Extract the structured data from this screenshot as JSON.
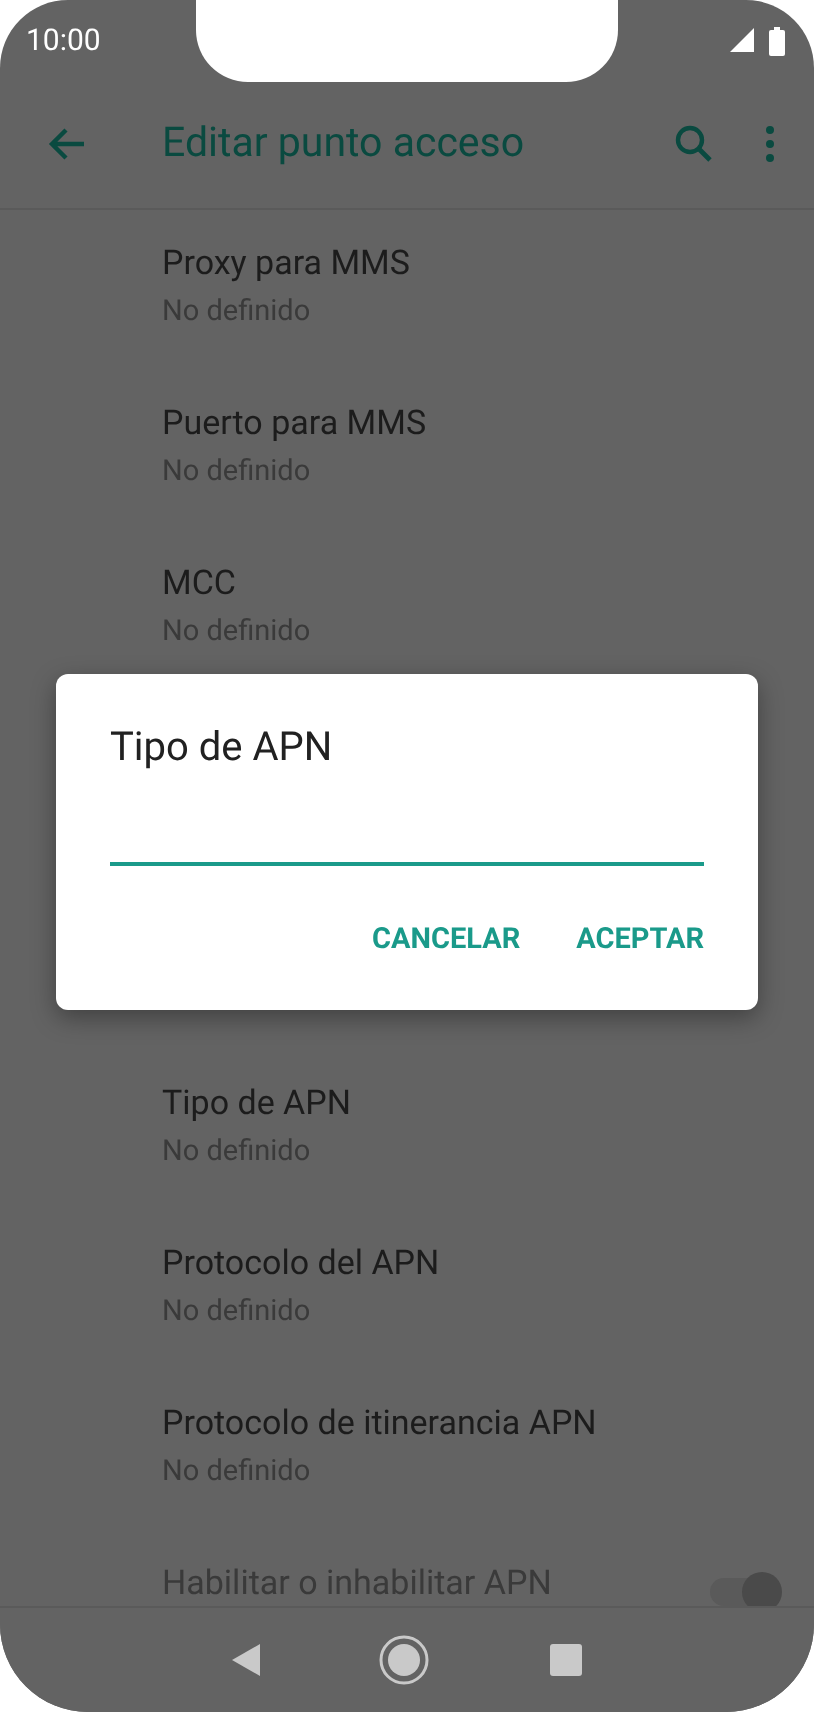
{
  "status_bar": {
    "time": "10:00"
  },
  "app_bar": {
    "title": "Editar punto acceso"
  },
  "settings": [
    {
      "kind": "text",
      "title": "Proxy para MMS",
      "value": "No definido"
    },
    {
      "kind": "text",
      "title": "Puerto para MMS",
      "value": "No definido"
    },
    {
      "kind": "text",
      "title": "MCC",
      "value": "No definido"
    }
  ],
  "dialog": {
    "title": "Tipo de APN",
    "buttons": [
      "CANCELAR",
      "ACEPTAR"
    ]
  },
  "settings_below": [
    {
      "kind": "text",
      "title": "Tipo de APN",
      "value": "No definido"
    },
    {
      "kind": "text",
      "title": "Protocolo del APN",
      "value": "No definido"
    },
    {
      "kind": "text",
      "title": "Protocolo de itinerancia APN",
      "value": "No definido"
    },
    {
      "kind": "switch",
      "title": "Habilitar o inhabilitar APN",
      "disabled": true,
      "on": true
    }
  ]
}
